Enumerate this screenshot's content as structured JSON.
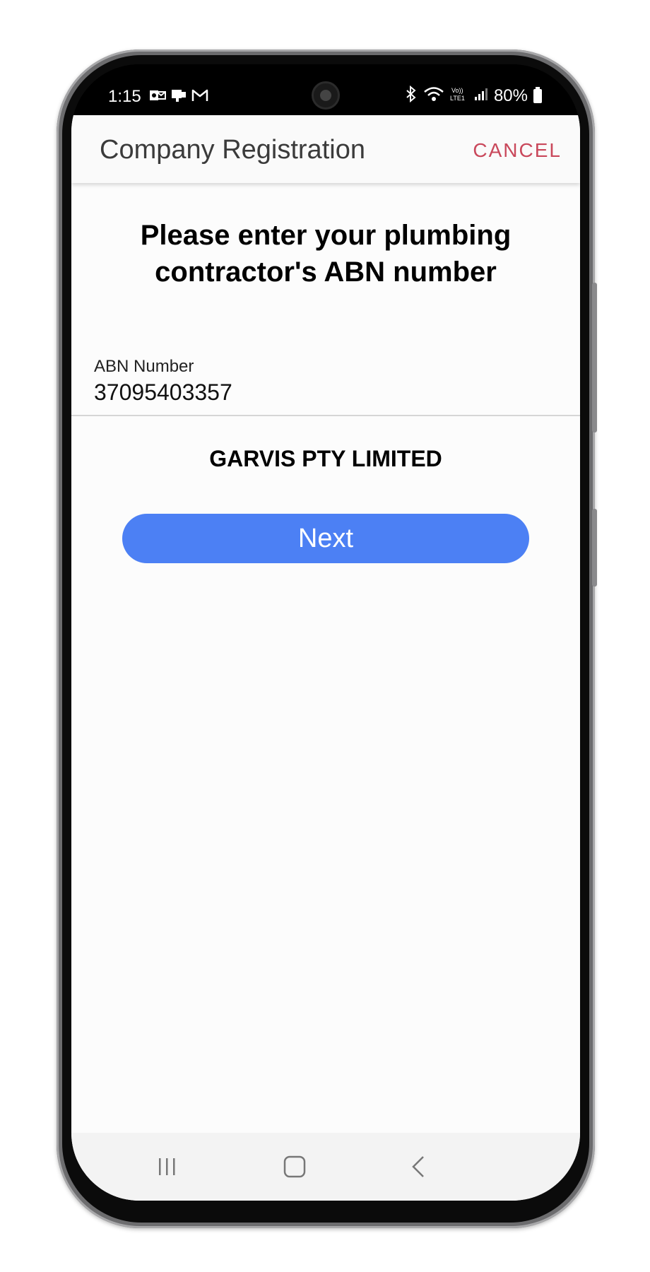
{
  "status_bar": {
    "time": "1:15",
    "battery": "80%"
  },
  "appbar": {
    "title": "Company Registration",
    "cancel_label": "CANCEL"
  },
  "main": {
    "heading_line1": "Please enter your plumbing",
    "heading_line2": "contractor's ABN number",
    "abn_field": {
      "label": "ABN Number",
      "value": "37095403357"
    },
    "company_name": "GARVIS PTY LIMITED",
    "next_label": "Next"
  },
  "colors": {
    "accent_button": "#4c80f4",
    "cancel": "#c9485b"
  },
  "nav_bar": {
    "icons": [
      "recents-icon",
      "home-icon",
      "back-icon"
    ]
  }
}
